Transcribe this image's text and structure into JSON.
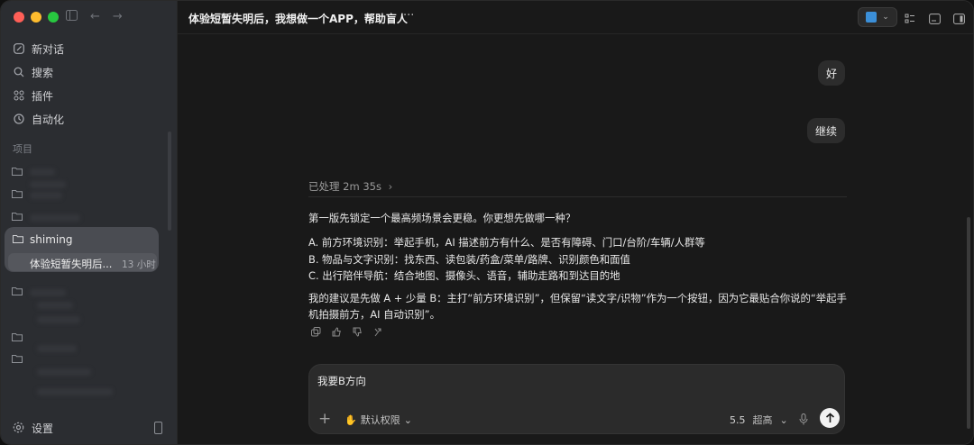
{
  "sidebar": {
    "nav": [
      {
        "label": "新对话",
        "icon": "compose-icon"
      },
      {
        "label": "搜索",
        "icon": "search-icon"
      },
      {
        "label": "插件",
        "icon": "plugins-icon"
      },
      {
        "label": "自动化",
        "icon": "clock-icon"
      }
    ],
    "projects_label": "项目",
    "active_project": "shiming",
    "active_thread": {
      "title": "体验短暂失明后...",
      "time": "13 小时"
    },
    "settings_label": "设置"
  },
  "header": {
    "title": "体验短暂失明后，我想做一个APP，帮助盲人",
    "more": "···"
  },
  "chat": {
    "user_messages": [
      "好",
      "继续"
    ],
    "processed": "已处理 2m 35s",
    "answer_intro": "第一版先锁定一个最高频场景会更稳。你更想先做哪一种？",
    "options": [
      "A. 前方环境识别：举起手机，AI 描述前方有什么、是否有障碍、门口/台阶/车辆/人群等",
      "B. 物品与文字识别：找东西、读包装/药盒/菜单/路牌、识别颜色和面值",
      "C. 出行陪伴导航：结合地图、摄像头、语音，辅助走路和到达目的地"
    ],
    "suggestion_line1": "我的建议是先做 A + 少量 B：主打“前方环境识别”，但保留“读文字/识物”作为一个按钮，因为它最贴合你说的“举起手",
    "suggestion_line2": "机拍摄前方，AI 自动识别”。"
  },
  "composer": {
    "value": "我要B方向",
    "permission": "默认权限",
    "model": "5.5",
    "quality": "超高"
  }
}
